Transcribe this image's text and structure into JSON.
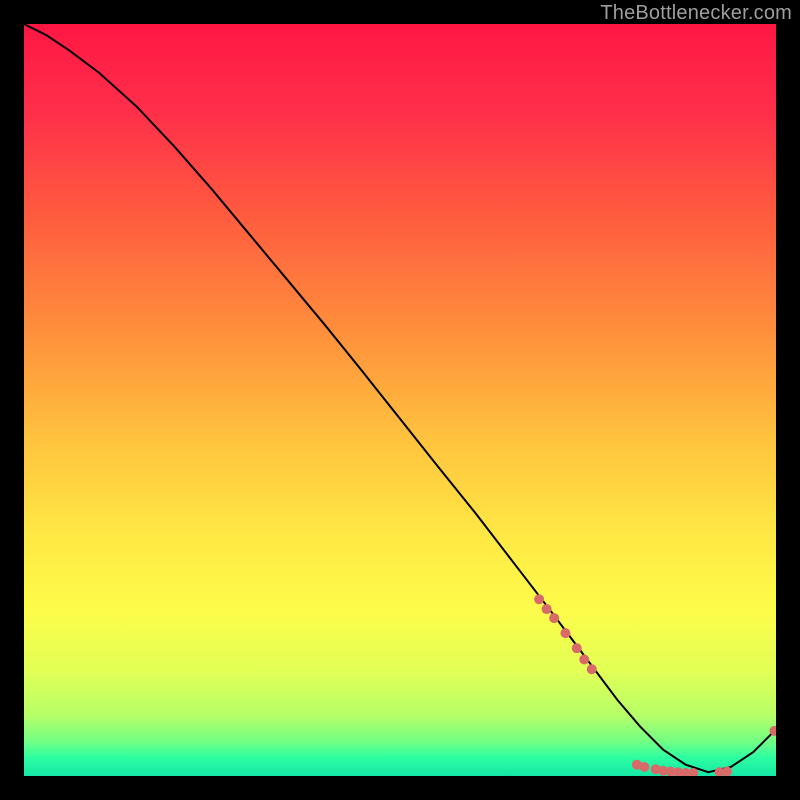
{
  "watermark": "TheBottlenecker.com",
  "chart_data": {
    "type": "line",
    "title": "",
    "xlabel": "",
    "ylabel": "",
    "xlim": [
      0,
      100
    ],
    "ylim": [
      0,
      100
    ],
    "grid": false,
    "legend": false,
    "background_gradient": {
      "stops": [
        {
          "pos": 0.0,
          "color": "#ff1744"
        },
        {
          "pos": 0.12,
          "color": "#ff304a"
        },
        {
          "pos": 0.25,
          "color": "#ff5a3f"
        },
        {
          "pos": 0.4,
          "color": "#ff8c3c"
        },
        {
          "pos": 0.55,
          "color": "#ffc23e"
        },
        {
          "pos": 0.68,
          "color": "#ffe844"
        },
        {
          "pos": 0.78,
          "color": "#fdfc4a"
        },
        {
          "pos": 0.86,
          "color": "#e2ff55"
        },
        {
          "pos": 0.92,
          "color": "#b5ff68"
        },
        {
          "pos": 0.955,
          "color": "#70ff85"
        },
        {
          "pos": 0.975,
          "color": "#2effa1"
        },
        {
          "pos": 1.0,
          "color": "#14e6a6"
        }
      ]
    },
    "series": [
      {
        "name": "bottleneck-curve",
        "color": "#000000",
        "x": [
          0,
          3,
          6,
          10,
          15,
          20,
          25,
          30,
          35,
          40,
          45,
          50,
          55,
          60,
          65,
          70,
          73,
          76,
          79,
          82,
          85,
          88,
          91,
          94,
          97,
          100
        ],
        "y": [
          100,
          98.5,
          96.5,
          93.5,
          89,
          83.7,
          78,
          72,
          66,
          60,
          53.8,
          47.5,
          41.2,
          35,
          28.5,
          22,
          18,
          14,
          10,
          6.5,
          3.5,
          1.5,
          0.5,
          1.2,
          3.2,
          6.2
        ]
      }
    ],
    "markers": {
      "name": "highlight-dots",
      "color": "#d86a6a",
      "radius": 5,
      "points": [
        {
          "x": 68.5,
          "y": 23.5
        },
        {
          "x": 69.5,
          "y": 22.2
        },
        {
          "x": 70.5,
          "y": 21.0
        },
        {
          "x": 72.0,
          "y": 19.0
        },
        {
          "x": 73.5,
          "y": 17.0
        },
        {
          "x": 74.5,
          "y": 15.5
        },
        {
          "x": 75.5,
          "y": 14.2
        },
        {
          "x": 81.5,
          "y": 1.5
        },
        {
          "x": 82.5,
          "y": 1.2
        },
        {
          "x": 84.0,
          "y": 0.9
        },
        {
          "x": 85.0,
          "y": 0.7
        },
        {
          "x": 86.0,
          "y": 0.6
        },
        {
          "x": 87.0,
          "y": 0.5
        },
        {
          "x": 88.0,
          "y": 0.4
        },
        {
          "x": 89.0,
          "y": 0.4
        },
        {
          "x": 92.5,
          "y": 0.5
        },
        {
          "x": 93.5,
          "y": 0.6
        },
        {
          "x": 99.8,
          "y": 6.0
        }
      ]
    }
  }
}
